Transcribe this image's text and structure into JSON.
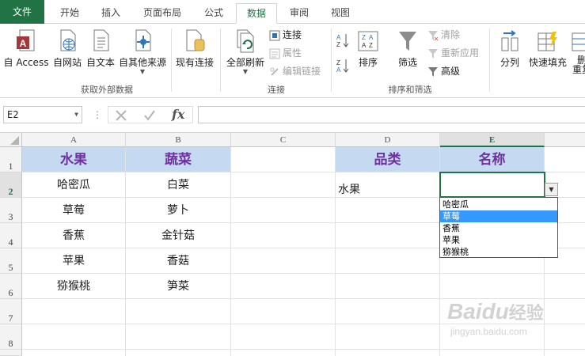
{
  "tabs": [
    {
      "label": "文件"
    },
    {
      "label": "开始"
    },
    {
      "label": "插入"
    },
    {
      "label": "页面布局"
    },
    {
      "label": "公式"
    },
    {
      "label": "数据"
    },
    {
      "label": "审阅"
    },
    {
      "label": "视图"
    }
  ],
  "ribbon": {
    "external": {
      "access": "自 Access",
      "web": "自网站",
      "text": "自文本",
      "other": "自其他来源",
      "existing": "现有连接",
      "group_label": "获取外部数据"
    },
    "connections": {
      "refresh_all": "全部刷新",
      "connections": "连接",
      "properties": "属性",
      "edit_links": "编辑链接",
      "group_label": "连接"
    },
    "sort_filter": {
      "sort": "排序",
      "filter": "筛选",
      "clear": "清除",
      "reapply": "重新应用",
      "advanced": "高级",
      "group_label": "排序和筛选"
    },
    "data_tools": {
      "split": "分列",
      "flash_fill": "快速填充",
      "remove_dup_line1": "删",
      "remove_dup_line2": "重复"
    }
  },
  "formula_bar": {
    "name_box": "E2",
    "fx": "fx",
    "formula": ""
  },
  "columns": [
    "A",
    "B",
    "C",
    "D",
    "E"
  ],
  "rows": [
    "1",
    "2",
    "3",
    "4",
    "5",
    "6",
    "7",
    "8"
  ],
  "cells": {
    "A1": "水果",
    "B1": "蔬菜",
    "D1": "品类",
    "E1": "名称",
    "A2": "哈密瓜",
    "B2": "白菜",
    "D2": "水果",
    "A3": "草莓",
    "B3": "萝卜",
    "A4": "香蕉",
    "B4": "金针菇",
    "A5": "苹果",
    "B5": "香菇",
    "A6": "猕猴桃",
    "B6": "笋菜"
  },
  "dropdown": {
    "items": [
      "哈密瓜",
      "草莓",
      "香蕉",
      "苹果",
      "猕猴桃"
    ],
    "highlighted_index": 1
  },
  "colors": {
    "accent": "#217346",
    "header_fill": "#c5d9f1",
    "header_text": "#7030a0",
    "highlight": "#3399ff"
  },
  "watermark": {
    "brand": "Baidu",
    "cn": "经验",
    "url": "jingyan.baidu.com"
  }
}
